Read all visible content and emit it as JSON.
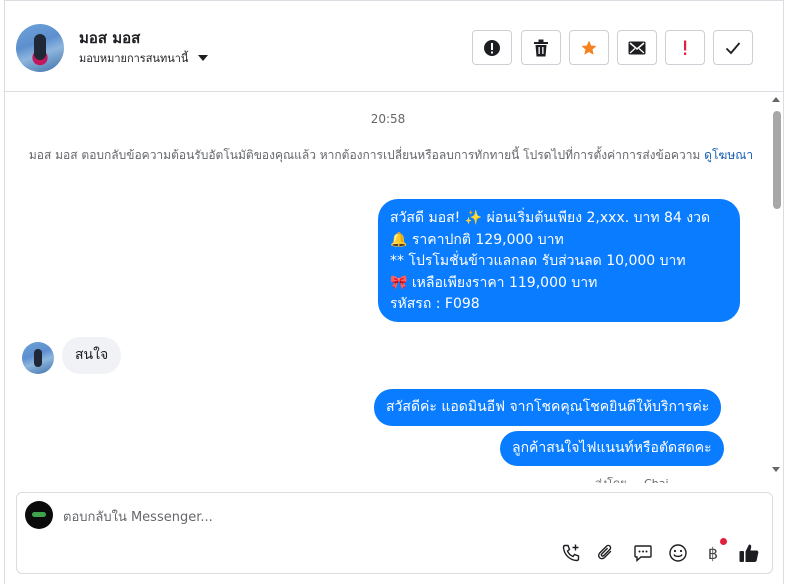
{
  "header": {
    "contact_name": "มอส มอส",
    "assign_label": "มอบหมายการสนทนานี้",
    "actions": [
      {
        "name": "mark-spam",
        "icon": "alert-circle-icon"
      },
      {
        "name": "delete",
        "icon": "trash-icon"
      },
      {
        "name": "star",
        "icon": "star-icon",
        "color": "#f5811f"
      },
      {
        "name": "mark-unread",
        "icon": "envelope-icon"
      },
      {
        "name": "follow-up",
        "icon": "exclamation-icon",
        "color": "#e41e3f"
      },
      {
        "name": "mark-done",
        "icon": "checkmark-icon"
      }
    ]
  },
  "chat": {
    "timestamp": "20:58",
    "system_message": "มอส มอส ตอบกลับข้อความต้อนรับอัตโนมัติของคุณแล้ว หากต้องการเปลี่ยนหรือลบการทักทายนี้ โปรดไปที่การตั้งค่าการส่งข้อความ",
    "system_link": "ดูโฆษณา",
    "promo_lines": [
      "สวัสดี มอส! ✨  ผ่อนเริ่มต้นเพียง 2,xxx. บาท 84 งวด",
      "🔔 ราคาปกติ 129,000 บาท",
      "** โปรโมชั่นข้าวแลกลด รับส่วนลด 10,000 บาท",
      "🎀  เหลือเพียงราคา 119,000 บาท",
      " รหัสรถ : F098"
    ],
    "incoming_1": "สนใจ",
    "outgoing_2": "สวัสดีค่ะ แอดมินอีฟ จากโชคคุณโชคยินดีให้บริการค่ะ",
    "outgoing_3": "ลูกค้าสนใจไฟแนนท์หรือตัดสดคะ",
    "cutoff_text": "ส่งโดย ... Chai..."
  },
  "composer": {
    "placeholder": "ตอบกลับใน Messenger...",
    "tools": [
      "phone-plus-icon",
      "paperclip-icon",
      "chat-bubble-icon",
      "smiley-icon",
      "baht-icon",
      "thumbs-up-icon"
    ],
    "baht_symbol": "฿"
  },
  "colors": {
    "accent": "#0a7cff",
    "incoming_bubble": "#f0f2f5",
    "link": "#1a5fb4"
  }
}
